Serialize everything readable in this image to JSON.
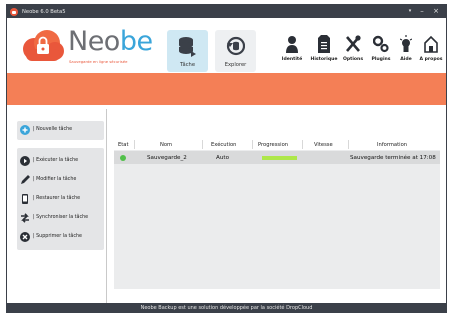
{
  "window": {
    "title": "Neobe 6.0 Beta5",
    "app_icon": "neobe-cloud-icon",
    "controls": [
      "menu-icon",
      "minimize-icon",
      "close-icon"
    ]
  },
  "logo": {
    "name_part1": "Neo",
    "name_part2": "be",
    "tagline": "Sauvegarde en ligne sécurisée"
  },
  "main_buttons": [
    {
      "label": "Tâche",
      "icon": "database-icon",
      "active": true
    },
    {
      "label": "Explorer",
      "icon": "restore-icon",
      "active": false
    }
  ],
  "toolbar": [
    {
      "label": "Identité",
      "icon": "user-icon"
    },
    {
      "label": "Historique",
      "icon": "document-icon"
    },
    {
      "label": "Options",
      "icon": "tools-icon"
    },
    {
      "label": "Plugins",
      "icon": "gears-icon"
    },
    {
      "label": "Aide",
      "icon": "lightbulb-icon"
    },
    {
      "label": "A propos",
      "icon": "home-icon"
    }
  ],
  "sidebar": {
    "new_task": "| Nouvelle tâche",
    "items": [
      {
        "label": "| Exécuter la tâche",
        "icon": "play-icon"
      },
      {
        "label": "| Modifier la tâche",
        "icon": "pencil-icon"
      },
      {
        "label": "| Restaurer la tâche",
        "icon": "phone-restore-icon"
      },
      {
        "label": "| Synchroniser la tâche",
        "icon": "sync-icon"
      },
      {
        "label": "| Supprimer la tâche",
        "icon": "delete-icon"
      }
    ]
  },
  "table": {
    "headers": [
      "Etat",
      "Nom",
      "Exécution",
      "Progression",
      "Vitesse",
      "Information"
    ],
    "rows": [
      {
        "status": "ok",
        "name": "Sauvegarde_2",
        "execution": "Auto",
        "progress": 1.0,
        "speed": "",
        "information": "Sauvegarde terminée at 17:08"
      }
    ]
  },
  "footer": {
    "text": "Neobe Backup est une solution développée par la société DropCloud"
  },
  "colors": {
    "accent_orange": "#f47f56",
    "brand_blue": "#3aa5da",
    "dark_bar": "#3b4049",
    "status_green": "#51c04a",
    "progress_green": "#aee74a"
  }
}
